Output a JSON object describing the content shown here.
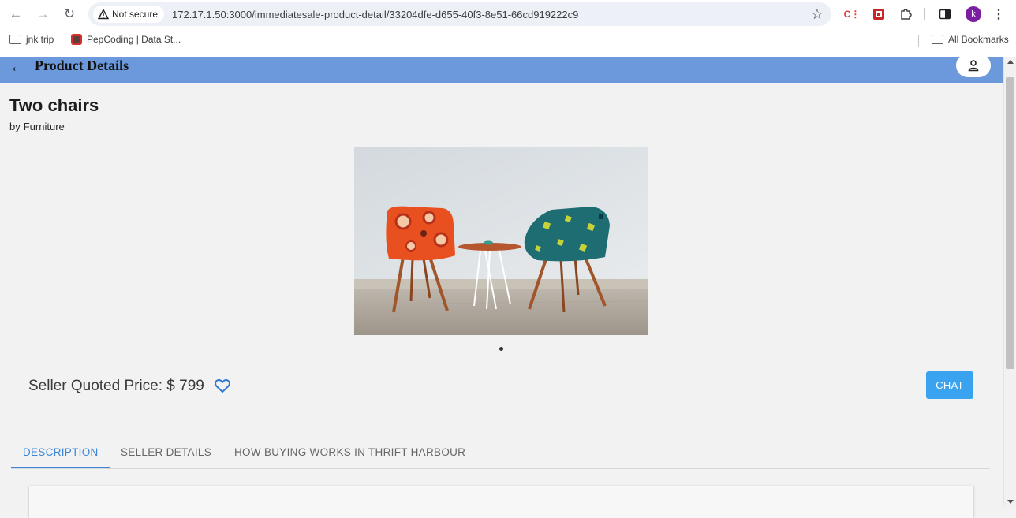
{
  "browser": {
    "security_label": "Not secure",
    "url": "172.17.1.50:3000/immediatesale-product-detail/33204dfe-d655-40f3-8e51-66cd919222c9",
    "profile_initial": "k",
    "bookmarks": [
      {
        "label": "jnk trip",
        "icon": "folder-icon"
      },
      {
        "label": "PepCoding | Data St...",
        "icon": "pepcoding-icon"
      }
    ],
    "all_bookmarks_label": "All Bookmarks"
  },
  "app_bar": {
    "title": "Product Details",
    "back_icon": "back-arrow-icon",
    "profile_icon": "person-icon",
    "color": "#6c98dc"
  },
  "product": {
    "title": "Two chairs",
    "by_label": "by",
    "category": "Furniture",
    "image_alt": "two-chairs-image",
    "carousel_dots": 1,
    "price_label": "Seller Quoted Price: $ 799",
    "favorite_icon": "heart-outline-icon"
  },
  "actions": {
    "chat_label": "CHAT",
    "chat_color": "#3aa3f0"
  },
  "tabs": [
    {
      "label": "DESCRIPTION",
      "active": true
    },
    {
      "label": "SELLER DETAILS",
      "active": false
    },
    {
      "label": "HOW BUYING WORKS IN THRIFT HARBOUR",
      "active": false
    }
  ],
  "colors": {
    "accent": "#3a86d8",
    "background": "#f2f2f2"
  }
}
